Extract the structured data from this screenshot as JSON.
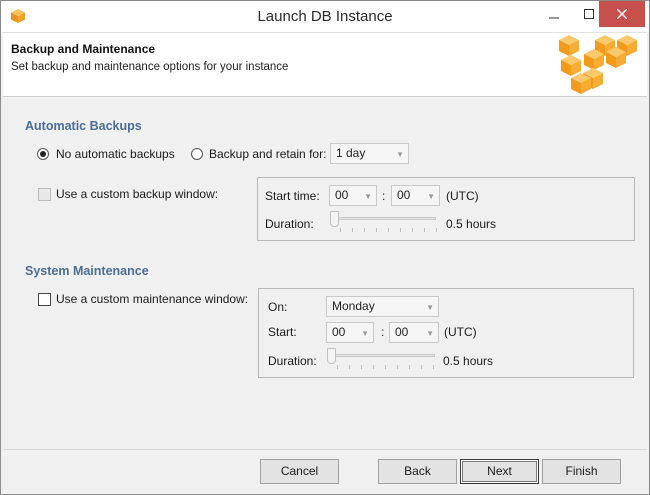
{
  "window": {
    "title": "Launch DB Instance"
  },
  "banner": {
    "title": "Backup and Maintenance",
    "subtitle": "Set backup and maintenance options for your instance"
  },
  "backups": {
    "section_title": "Automatic Backups",
    "no_backups_label": "No automatic backups",
    "no_backups_selected": true,
    "retain_label": "Backup and retain for:",
    "retain_selected": false,
    "retain_value": "1 day",
    "custom_window_label": "Use a custom backup window:",
    "custom_window_checked": false,
    "start_time_label": "Start time:",
    "start_hour": "00",
    "start_minute": "00",
    "time_sep": ":",
    "tz": "(UTC)",
    "duration_label": "Duration:",
    "duration_value": "0.5 hours",
    "duration_fraction": 0.0
  },
  "maintenance": {
    "section_title": "System Maintenance",
    "custom_window_label": "Use a custom maintenance window:",
    "custom_window_checked": false,
    "on_label": "On:",
    "day_value": "Monday",
    "start_label": "Start:",
    "start_hour": "00",
    "start_minute": "00",
    "time_sep": ":",
    "tz": "(UTC)",
    "duration_label": "Duration:",
    "duration_value": "0.5 hours",
    "duration_fraction": 0.0
  },
  "footer": {
    "cancel_label": "Cancel",
    "back_label": "Back",
    "next_label": "Next",
    "finish_label": "Finish"
  },
  "colors": {
    "section_title": "#4b6d96",
    "close_button": "#c7504c",
    "aws_orange": "#f7a81b"
  },
  "icons": {
    "app": "aws-cube-icon",
    "minimize": "minimize-icon",
    "maximize": "maximize-icon",
    "close": "close-icon",
    "logo": "aws-logo-cubes",
    "dropdown": "chevron-down-icon"
  }
}
